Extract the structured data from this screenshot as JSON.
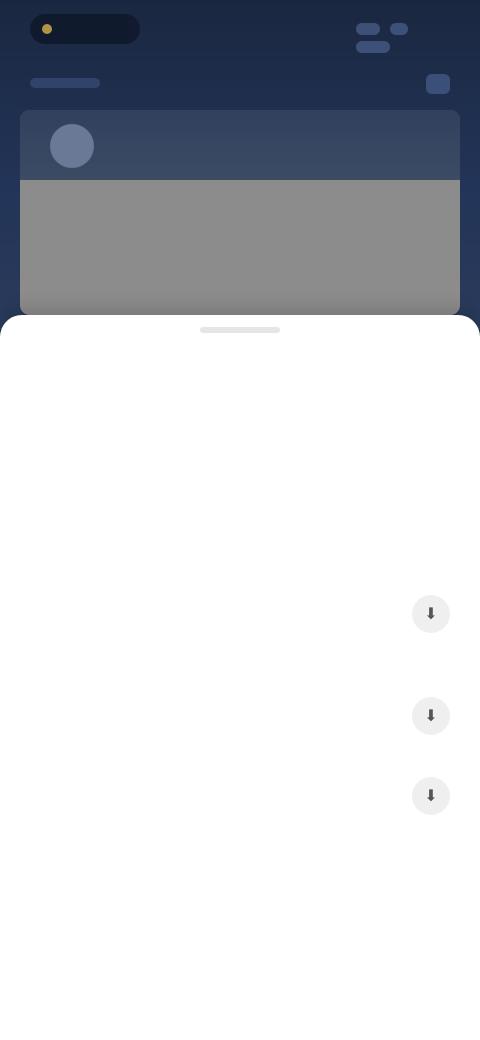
{
  "status": {
    "time": ""
  },
  "header": {
    "title": ""
  },
  "sheet": {
    "section1_title": "",
    "meta": [
      {
        "label": "",
        "value": ""
      },
      {
        "label": "",
        "value": ""
      },
      {
        "label": "",
        "value": ""
      }
    ],
    "section2_title": "",
    "items": [
      {
        "title": "",
        "subtitle": "",
        "icon": "download-icon"
      },
      {
        "title": "",
        "subtitle": "",
        "icon": "download-icon"
      },
      {
        "title": "",
        "subtitle": "",
        "icon": "download-icon"
      }
    ],
    "footer": {
      "item1": "",
      "item2": "",
      "item3": ""
    }
  },
  "colors": {
    "header_bg": "#1c2a45",
    "sheet_bg": "#ffffff",
    "card_gray": "#8c8c8c"
  }
}
